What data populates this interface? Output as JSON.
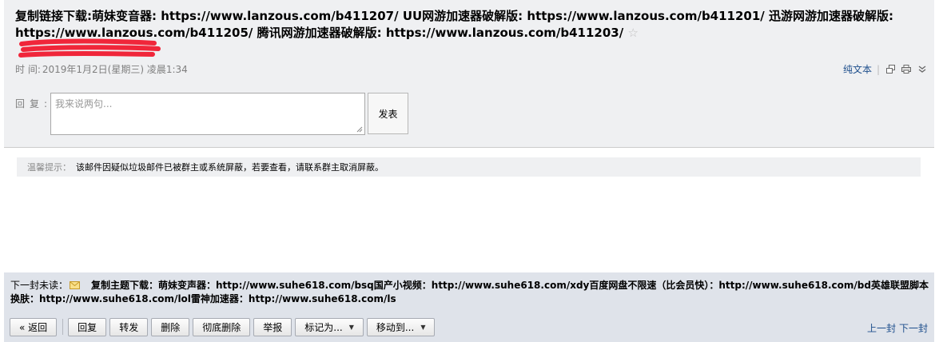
{
  "mail": {
    "subject": "复制链接下载:萌妹变音器: https://www.lanzous.com/b411207/ UU网游加速器破解版: https://www.lanzous.com/b411201/ 迅游网游加速器破解版: https://www.lanzous.com/b411205/ 腾讯网游加速器破解版: https://www.lanzous.com/b411203/",
    "star": "☆",
    "time_label": "时 间:",
    "time_value": "2019年1月2日(星期三) 凌晨1:34"
  },
  "tools": {
    "plain_text": "纯文本",
    "separator": "|",
    "open_new_icon": "open-window-icon",
    "print_icon": "printer-icon",
    "more": "»"
  },
  "reply": {
    "label": "回复:",
    "placeholder": "我来说两句...",
    "send": "发表"
  },
  "notice": {
    "label": "温馨提示：",
    "text": "该邮件因疑似垃圾邮件已被群主或系统屏蔽，若要查看，请联系群主取消屏蔽。"
  },
  "footer": {
    "next_unread_label": "下一封未读：",
    "next_unread_subject": "复制主题下载：萌妹变声器：http://www.suhe618.com/bsq国产小视频：http://www.suhe618.com/xdy百度网盘不限速（比会员快）：http://www.suhe618.com/bd英雄联盟脚本换肤：http://www.suhe618.com/lol雷神加速器：http://www.suhe618.com/ls",
    "buttons": {
      "back": "« 返回",
      "reply": "回复",
      "forward": "转发",
      "delete": "删除",
      "delete_permanent": "彻底删除",
      "report": "举报",
      "mark_as": "标记为...",
      "move_to": "移动到..."
    },
    "prev": "上一封",
    "next": "下一封"
  },
  "colors": {
    "header_bg": "#eff0f2",
    "footer_bg": "#dfe3ea",
    "link": "#1d4e8c",
    "redaction": "#f0263a"
  }
}
